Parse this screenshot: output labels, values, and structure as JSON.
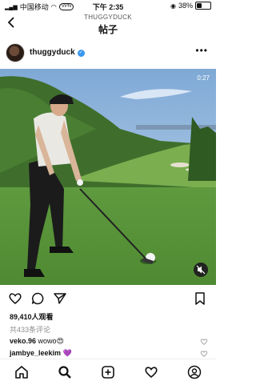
{
  "status_bar": {
    "carrier": "中国移动",
    "vpn": "VPN",
    "time": "下午 2:35",
    "battery": "38%",
    "battery_level": 0.38
  },
  "header": {
    "account": "THUGGYDUCK",
    "title": "帖子"
  },
  "post": {
    "username": "thuggyduck",
    "verified": true,
    "video_time": "0:27",
    "views": "89,410人观看",
    "comments_link": "共433条评论",
    "comments": [
      {
        "user": "veko.96",
        "text": "wowo😍"
      },
      {
        "user": "jambye_leekim",
        "text": "💜"
      }
    ]
  },
  "icons": {
    "back": "chevron-left-icon",
    "more": "more-dots-icon",
    "like": "heart-icon",
    "comment": "comment-icon",
    "share": "send-icon",
    "save": "bookmark-icon",
    "mute": "mute-icon"
  },
  "tabbar": [
    "home-icon",
    "search-icon",
    "add-post-icon",
    "activity-heart-icon",
    "profile-icon"
  ]
}
